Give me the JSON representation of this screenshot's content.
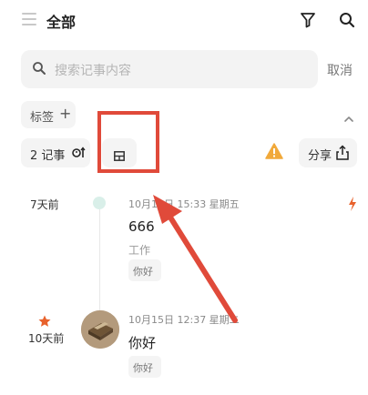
{
  "header": {
    "title": "全部",
    "menu_icon": "menu-icon",
    "filter_icon": "filter-icon",
    "search_icon": "search-icon"
  },
  "search": {
    "placeholder": "搜索记事内容",
    "cancel_label": "取消"
  },
  "tags": {
    "label": "标签",
    "add_symbol": "+"
  },
  "toolbar": {
    "count_label": "2 记事",
    "share_label": "分享"
  },
  "entries": [
    {
      "relative_time": "7天前",
      "date": "10月16日 15:33 星期五",
      "title": "666",
      "category": "工作",
      "tag": "你好"
    },
    {
      "relative_time": "10天前",
      "date": "10月15日 12:37 星期二",
      "title": "你好",
      "tag": "你好"
    }
  ],
  "colors": {
    "annotation_red": "#e04a3a",
    "accent_orange": "#e8622c",
    "warning_yellow": "#f1a93a",
    "chip_bg": "#f4f4f4"
  }
}
